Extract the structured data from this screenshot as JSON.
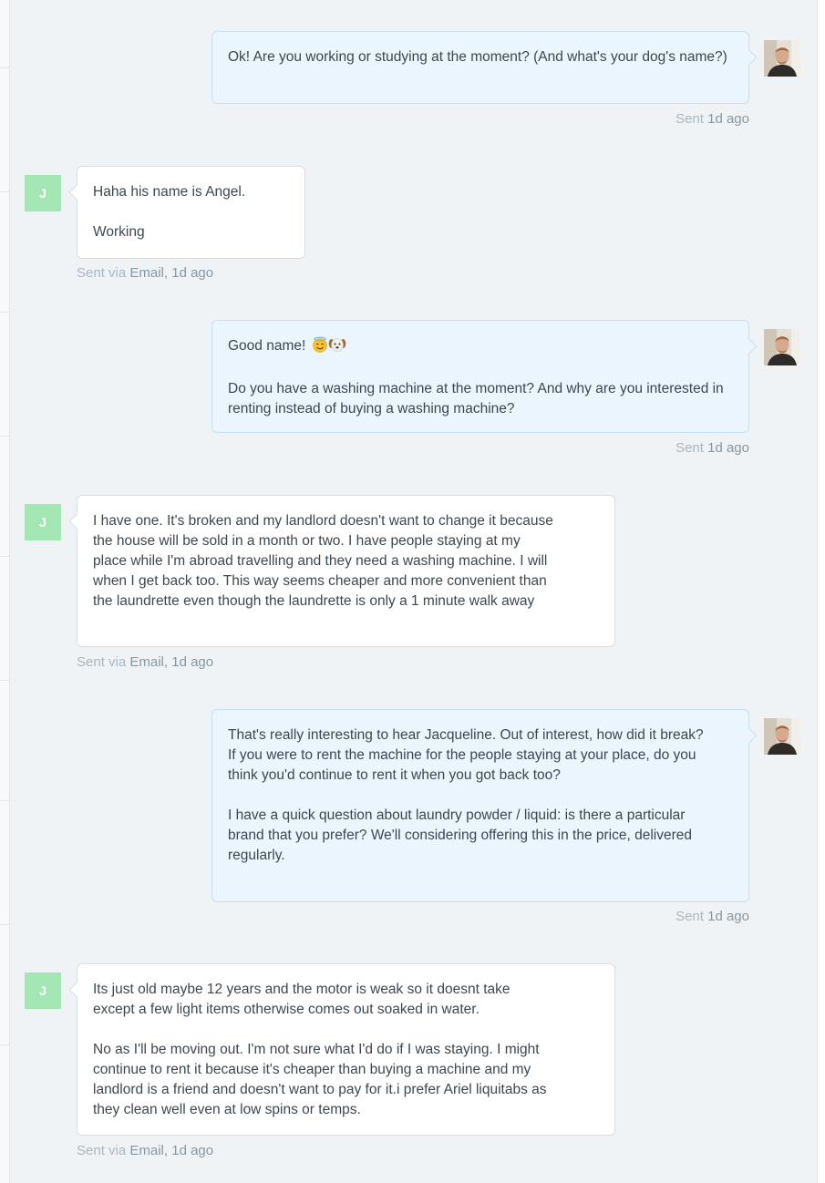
{
  "contact": {
    "initial": "J"
  },
  "messages": [
    {
      "direction": "outgoing",
      "paragraphs": [
        "Ok! Are you working or studying at the moment? (And what's your dog's name?)"
      ],
      "meta": {
        "label": "Sent",
        "time": "1d ago"
      }
    },
    {
      "direction": "incoming",
      "paragraphs": [
        "Haha his name is Angel.",
        "Working"
      ],
      "meta": {
        "label": "Sent via",
        "channel": "Email,",
        "time": "1d ago"
      }
    },
    {
      "direction": "outgoing",
      "paragraphs": [
        "Good name!",
        "Do you have a washing machine at the moment? And why are you interested in renting instead of buying a washing machine?"
      ],
      "emoji": [
        "smiling-face-with-halo-emoji",
        "dog-face-emoji"
      ],
      "meta": {
        "label": "Sent",
        "time": "1d ago"
      }
    },
    {
      "direction": "incoming",
      "paragraphs": [
        "I have one. It's broken and my landlord doesn't want to change it because the house will be sold in a month or two. I have people staying at my place while I'm abroad travelling and they need a washing machine. I will when I get back too. This way seems cheaper and more convenient than the laundrette even though the laundrette is only a 1 minute walk away"
      ],
      "meta": {
        "label": "Sent via",
        "channel": "Email,",
        "time": "1d ago"
      }
    },
    {
      "direction": "outgoing",
      "paragraphs": [
        "That's really interesting to hear Jacqueline. Out of interest, how did it break? If you were to rent the machine for the people staying at your place, do you think you'd continue to rent it when you got back too?",
        "I have a quick question about laundry powder / liquid: is there a particular brand that you prefer? We'll considering offering this in the price, delivered regularly."
      ],
      "meta": {
        "label": "Sent",
        "time": "1d ago"
      }
    },
    {
      "direction": "incoming",
      "paragraphs": [
        "Its just old maybe 12 years and the motor is weak so it doesnt take except a few light items otherwise comes out soaked in water.",
        "No as I'll be moving out. I'm not sure what I'd do if I was staying. I might continue to rent it because it's cheaper than buying a machine and my landlord is a friend and doesn't want to pay for it.i prefer Ariel liquitabs as they clean well even at low spins or temps."
      ],
      "meta": {
        "label": "Sent via",
        "channel": "Email,",
        "time": "1d ago"
      }
    }
  ],
  "colors": {
    "thread_background": "#f0f3f6",
    "outgoing_bubble": "#eaf5fd",
    "incoming_bubble": "#ffffff",
    "contact_avatar": "#a4e6b4"
  }
}
